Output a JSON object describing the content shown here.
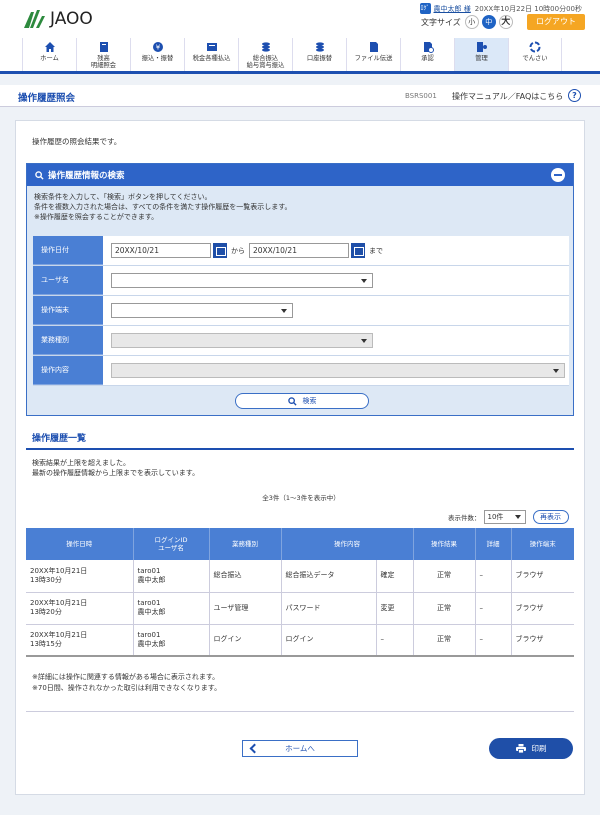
{
  "header": {
    "logo_text": "JAOO",
    "user_badge": "ﾛｸﾞ",
    "user_name": "農中太郎 様",
    "login_time": "20XX年10月22日 10時00分00秒",
    "font_size_label": "文字サイズ",
    "font_sizes": [
      "小",
      "中",
      "大"
    ],
    "logout_label": "ログアウト"
  },
  "nav": {
    "items": [
      {
        "label": "ホーム",
        "icon": "home-icon"
      },
      {
        "label": "残高\n明細照会",
        "icon": "passbook-icon"
      },
      {
        "label": "振込・振替",
        "icon": "transfer-icon"
      },
      {
        "label": "税金各種払込",
        "icon": "tax-icon"
      },
      {
        "label": "総合振込\n給与賞与振込",
        "icon": "payroll-icon"
      },
      {
        "label": "口座振替",
        "icon": "coins-icon"
      },
      {
        "label": "ファイル伝送",
        "icon": "file-icon"
      },
      {
        "label": "承認",
        "icon": "approval-icon"
      },
      {
        "label": "管理",
        "icon": "admin-icon"
      },
      {
        "label": "でんさい",
        "icon": "densai-icon"
      }
    ]
  },
  "page": {
    "title": "操作履歴照会",
    "screen_id": "BSRS001",
    "manual_link": "操作マニュアル／FAQはこちら",
    "help": "?",
    "intro": "操作履歴の照会結果です。"
  },
  "search": {
    "title": "操作履歴情報の検索",
    "desc": [
      "検索条件を入力して、「検索」ボタンを押してください。",
      "条件を複数入力された場合は、すべての条件を満たす操作履歴を一覧表示します。",
      "※操作履歴を照会することができます。"
    ],
    "fields": {
      "date_label": "操作日付",
      "date_from": "20XX/10/21",
      "date_between": "から",
      "date_to": "20XX/10/21",
      "date_suffix": "まで",
      "user_label": "ユーザ名",
      "terminal_label": "操作端末",
      "business_label": "業務種別",
      "content_label": "操作内容"
    },
    "button_label": "検索"
  },
  "list": {
    "title": "操作履歴一覧",
    "desc": [
      "検索結果が上限を超えました。",
      "最新の操作履歴情報から上限までを表示しています。"
    ],
    "count_text": "全3件（1～3件を表示中）",
    "per_page_label": "表示件数：",
    "per_page_value": "10件",
    "redisplay_label": "再表示",
    "columns": [
      "操作日時",
      "ログインID\nユーザ名",
      "業務種別",
      "操作内容",
      "操作結果",
      "詳細",
      "操作端末"
    ],
    "rows": [
      {
        "datetime": "20XX年10月21日\n13時30分",
        "login": "taro01\n農中太郎",
        "business": "総合振込",
        "content": "総合振込データ",
        "action": "確定",
        "result": "正常",
        "detail": "–",
        "terminal": "ブラウザ"
      },
      {
        "datetime": "20XX年10月21日\n13時20分",
        "login": "taro01\n農中太郎",
        "business": "ユーザ管理",
        "content": "パスワード",
        "action": "変更",
        "result": "正常",
        "detail": "–",
        "terminal": "ブラウザ"
      },
      {
        "datetime": "20XX年10月21日\n13時15分",
        "login": "taro01\n農中太郎",
        "business": "ログイン",
        "content": "ログイン",
        "action": "–",
        "result": "正常",
        "detail": "–",
        "terminal": "ブラウザ"
      }
    ],
    "notes": [
      "※詳細には操作に関連する情報がある場合に表示されます。",
      "※70日間、操作されなかった取引は利用できなくなります。"
    ]
  },
  "footer": {
    "home_label": "ホームへ",
    "print_label": "印刷"
  },
  "colors": {
    "brand_blue": "#1d4fb0",
    "header_blue": "#2e64c8",
    "label_blue": "#4a7fd4",
    "logout_orange": "#f5a623"
  }
}
